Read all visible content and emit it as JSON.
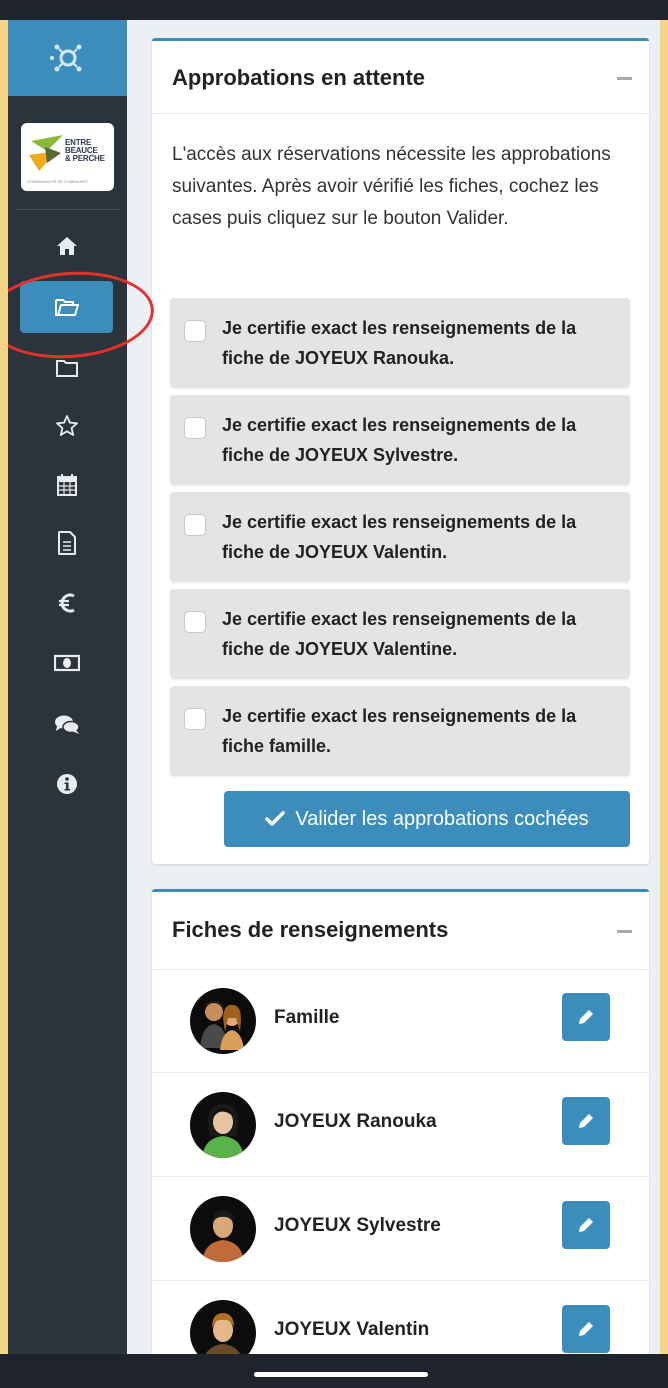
{
  "colors": {
    "accent": "#3c8dbc",
    "sidebar": "#2c343b",
    "annotation": "#e5302b",
    "background": "#ecf0f5"
  },
  "sidebar": {
    "brand": {
      "line1": "ENTRE",
      "line2": "BEAUCE",
      "line3": "& PERCHE",
      "subtitle": "COMMUNAUTÉ DE COMMUNES"
    },
    "items": [
      {
        "icon": "home-icon",
        "active": false
      },
      {
        "icon": "folder-open-icon",
        "active": true
      },
      {
        "icon": "folder-icon",
        "active": false
      },
      {
        "icon": "star-icon",
        "active": false
      },
      {
        "icon": "calendar-icon",
        "active": false
      },
      {
        "icon": "document-icon",
        "active": false
      },
      {
        "icon": "euro-icon",
        "active": false
      },
      {
        "icon": "money-icon",
        "active": false
      },
      {
        "icon": "comments-icon",
        "active": false
      },
      {
        "icon": "info-icon",
        "active": false
      }
    ]
  },
  "approvals": {
    "title": "Approbations en attente",
    "intro": "L'accès aux réservations nécessite les approbations suivantes. Après avoir vérifié les fiches, cochez les cases puis cliquez sur le bouton Valider.",
    "items": [
      {
        "line1": "Je certifie exact les renseignements de la",
        "line2": "fiche de JOYEUX Ranouka.",
        "checked": false
      },
      {
        "line1": "Je certifie exact les renseignements de la",
        "line2": "fiche de JOYEUX Sylvestre.",
        "checked": false
      },
      {
        "line1": "Je certifie exact les renseignements de la",
        "line2": "fiche de JOYEUX Valentin.",
        "checked": false
      },
      {
        "line1": "Je certifie exact les renseignements de la",
        "line2": "fiche de JOYEUX Valentine.",
        "checked": false
      },
      {
        "line1": "Je certifie exact les renseignements de la",
        "line2": "fiche famille.",
        "checked": false
      }
    ],
    "button_label": "Valider les approbations cochées"
  },
  "fiches": {
    "title": "Fiches de renseignements",
    "items": [
      {
        "name": "Famille",
        "avatar": "family-avatar-icon"
      },
      {
        "name": "JOYEUX Ranouka",
        "avatar": "female-avatar-icon"
      },
      {
        "name": "JOYEUX Sylvestre",
        "avatar": "male-avatar-icon"
      },
      {
        "name": "JOYEUX Valentin",
        "avatar": "male-avatar-icon"
      }
    ]
  }
}
